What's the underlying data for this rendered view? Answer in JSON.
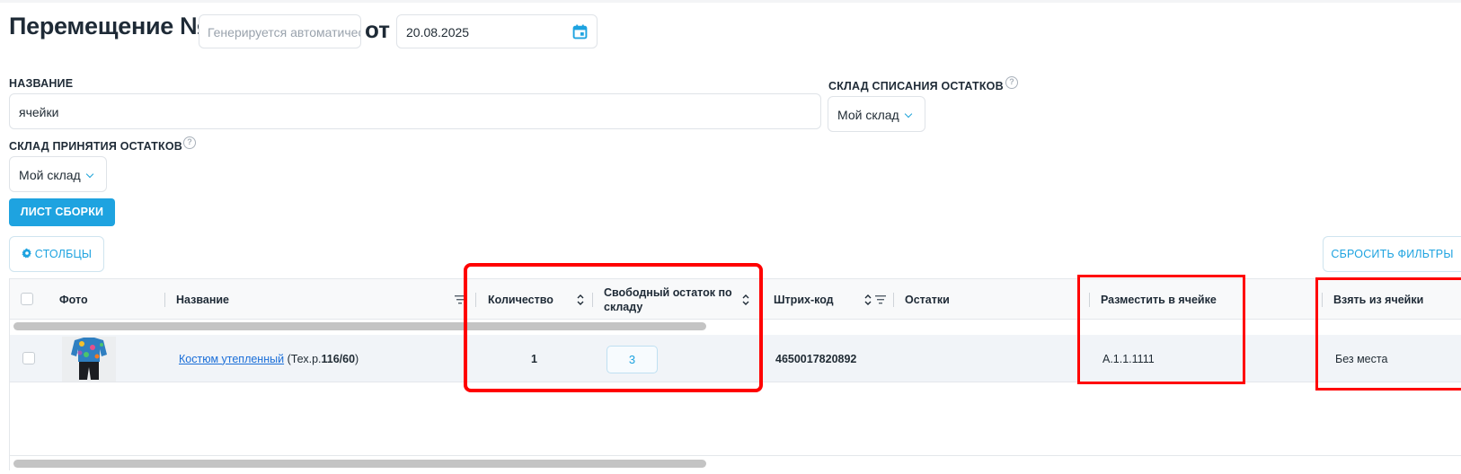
{
  "header": {
    "title": "Перемещение №",
    "number_placeholder": "Генерируется автоматически",
    "from_label": "от",
    "date": "20.08.2025"
  },
  "form": {
    "name_label": "НАЗВАНИЕ",
    "name_value": "ячейки",
    "source_warehouse_label": "СКЛАД СПИСАНИЯ ОСТАТКОВ",
    "source_warehouse_value": "Мой склад",
    "target_warehouse_label": "СКЛАД ПРИНЯТИЯ ОСТАТКОВ",
    "target_warehouse_value": "Мой склад",
    "help_glyph": "?"
  },
  "toolbar": {
    "assembly_sheet_label": "ЛИСТ СБОРКИ",
    "columns_label": "СТОЛБЦЫ",
    "reset_filters_label": "СБРОСИТЬ ФИЛЬТРЫ"
  },
  "table": {
    "columns": {
      "photo": "Фото",
      "name": "Название",
      "quantity": "Количество",
      "free_stock": "Свободный остаток по складу",
      "barcode": "Штрих-код",
      "stock": "Остатки",
      "place_in_cell": "Разместить в ячейке",
      "take_from_cell": "Взять из ячейки"
    },
    "rows": [
      {
        "product_link": "Костюм утепленный",
        "product_suffix_plain": "(Тех.р. ",
        "product_suffix_bold": "116/60",
        "product_suffix_close": ")",
        "quantity": "1",
        "free_stock": "3",
        "barcode": "4650017820892",
        "place_in_cell": "А.1.1.1111",
        "take_from_cell": "Без места"
      }
    ]
  },
  "colors": {
    "accent": "#1ea3e0",
    "highlight": "#ff0000",
    "link": "#1a6ed8"
  }
}
